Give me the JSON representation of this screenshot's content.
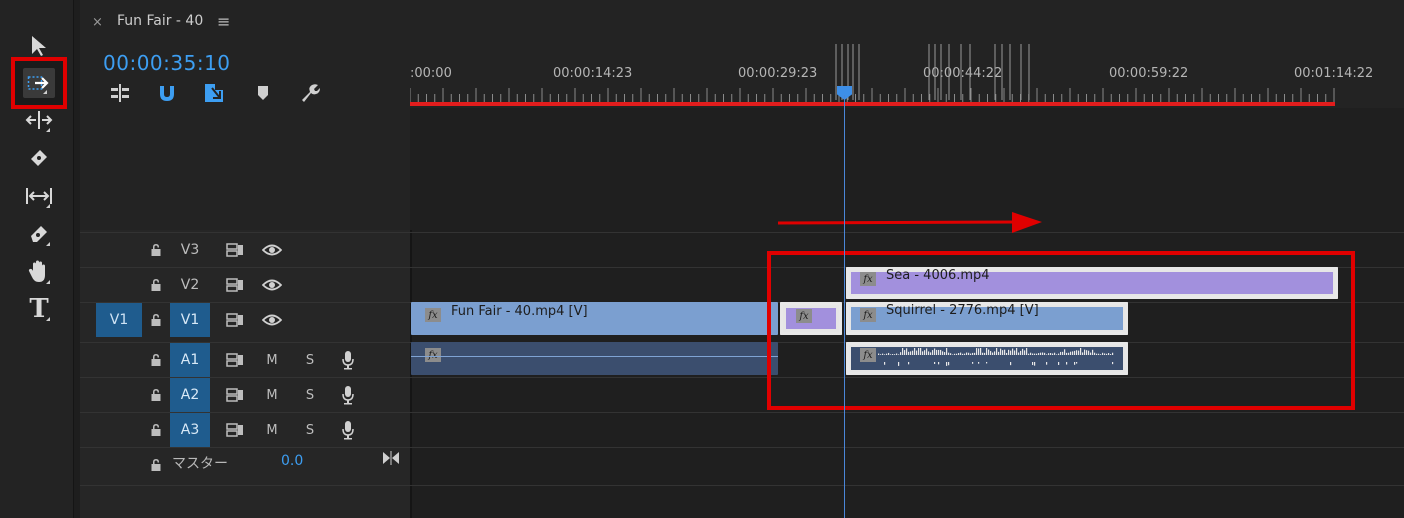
{
  "tab": {
    "close": "×",
    "title": "Fun Fair - 40",
    "menu": "≡"
  },
  "timecode": "00:00:35:10",
  "ruler": {
    "labels": [
      ":00:00",
      "00:00:14:23",
      "00:00:29:23",
      "00:00:44:22",
      "00:00:59:22",
      "00:01:14:22"
    ]
  },
  "tools": {
    "type_label": "T"
  },
  "tracks": {
    "v3": {
      "name": "V3"
    },
    "v2": {
      "name": "V2"
    },
    "v1": {
      "source": "V1",
      "name": "V1"
    },
    "a1": {
      "name": "A1",
      "mute": "M",
      "solo": "S"
    },
    "a2": {
      "name": "A2",
      "mute": "M",
      "solo": "S"
    },
    "a3": {
      "name": "A3",
      "mute": "M",
      "solo": "S"
    }
  },
  "master": {
    "label": "マスター",
    "value": "0.0"
  },
  "clips": {
    "fun_fair_video": "Fun Fair - 40.mp4 [V]",
    "sea": "Sea - 4006.mp4",
    "squirrel": "Squirrel - 2776.mp4 [V]",
    "fx": "fx"
  },
  "colors": {
    "accent": "#3d9ef2",
    "annotation_red": "#e00000",
    "video_clip": "#7b9fd0",
    "adjustment_clip": "#a290dd",
    "audio_clip": "#3b4e6e"
  }
}
